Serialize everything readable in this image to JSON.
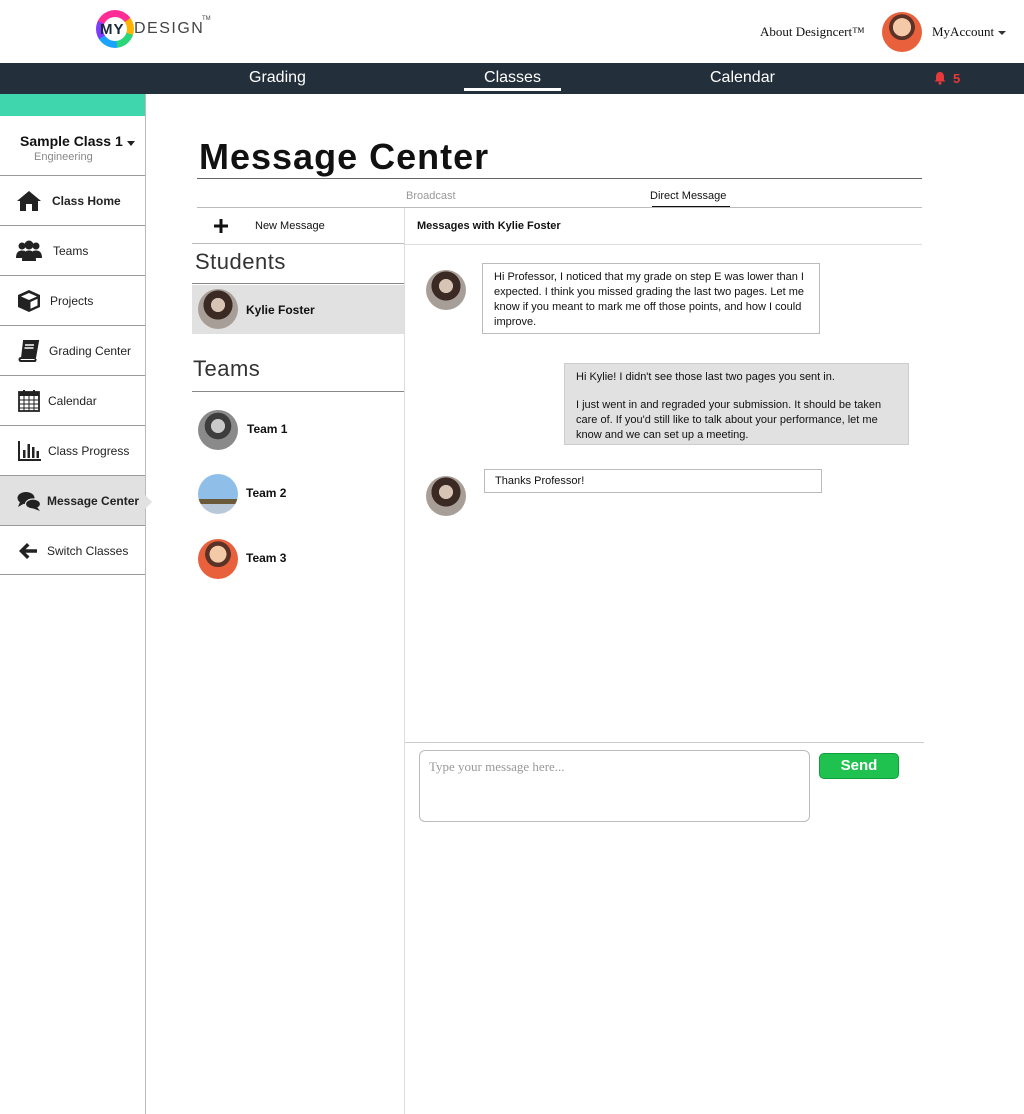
{
  "header": {
    "logo_text": "MyDesign",
    "about_link": "About Designcert™",
    "account_label": "MyAccount"
  },
  "topnav": {
    "items": [
      {
        "label": "Grading",
        "active": false
      },
      {
        "label": "Classes",
        "active": true
      },
      {
        "label": "Calendar",
        "active": false
      }
    ],
    "notification_count": "5"
  },
  "sidebar": {
    "class_name": "Sample Class 1",
    "class_subtitle": "Engineering",
    "items": [
      {
        "label": "Class Home",
        "icon": "home-icon"
      },
      {
        "label": "Teams",
        "icon": "users-icon"
      },
      {
        "label": "Projects",
        "icon": "cube-icon"
      },
      {
        "label": "Grading Center",
        "icon": "book-icon"
      },
      {
        "label": "Calendar",
        "icon": "calendar-icon"
      },
      {
        "label": "Class Progress",
        "icon": "bar-chart-icon"
      },
      {
        "label": "Message Center",
        "icon": "chat-icon",
        "active": true
      },
      {
        "label": "Switch Classes",
        "icon": "arrow-left-icon"
      }
    ]
  },
  "main": {
    "title": "Message Center",
    "tabs": [
      {
        "label": "Broadcast",
        "active": false
      },
      {
        "label": "Direct Message",
        "active": true
      }
    ],
    "new_message_label": "New Message",
    "students_heading": "Students",
    "students": [
      {
        "name": "Kylie  Foster",
        "selected": true
      }
    ],
    "teams_heading": "Teams",
    "teams": [
      {
        "name": "Team 1"
      },
      {
        "name": "Team 2"
      },
      {
        "name": "Team 3"
      }
    ]
  },
  "conversation": {
    "header": "Messages with Kylie Foster",
    "messages": [
      {
        "direction": "incoming",
        "paragraphs": [
          "Hi Professor, I noticed that my grade on step E was lower than I expected. I think you missed  grading the last two pages. Let me know if you meant to mark me off those points, and how I could improve."
        ]
      },
      {
        "direction": "outgoing",
        "paragraphs": [
          "Hi Kylie! I didn't see those last two pages you sent in.",
          "I just went in and regraded your submission. It should be taken care of. If you'd still like to talk about your performance, let me know and we can set up a meeting."
        ]
      },
      {
        "direction": "incoming",
        "paragraphs": [
          "Thanks Professor!"
        ]
      }
    ],
    "compose_placeholder": "Type your message here...",
    "send_label": "Send"
  },
  "colors": {
    "nav_bg": "#232f3a",
    "accent_teal": "#3fd6ae",
    "send_green": "#1fc24f",
    "notification_red": "#e8393a"
  }
}
